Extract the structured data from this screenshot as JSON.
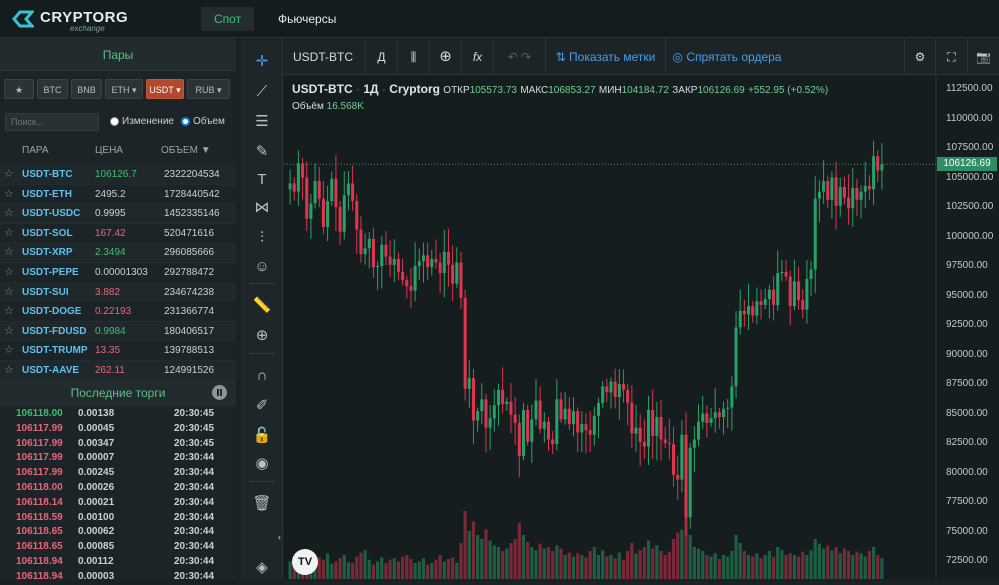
{
  "brand": {
    "name": "CRYPTORG",
    "sub": "exchange"
  },
  "nav": {
    "tabs": [
      {
        "label": "Спот",
        "active": true
      },
      {
        "label": "Фьючерсы",
        "active": false
      }
    ]
  },
  "pairs_panel": {
    "title": "Пары",
    "filters": [
      "BTC",
      "BNB",
      "ETH",
      "USDT",
      "RUB"
    ],
    "active_filter": "USDT",
    "search_placeholder": "Поиск...",
    "radio_change": "Изменение",
    "radio_volume": "Объем",
    "columns": {
      "pair": "ПАРА",
      "price": "ЦЕНА",
      "volume": "ОБЪЕМ ▼"
    },
    "rows": [
      {
        "pair": "USDT-BTC",
        "price": "106126.7",
        "volume": "2322204534",
        "trend": "up"
      },
      {
        "pair": "USDT-ETH",
        "price": "2495.2",
        "volume": "1728440542",
        "trend": "neu"
      },
      {
        "pair": "USDT-USDC",
        "price": "0.9995",
        "volume": "1452335146",
        "trend": "neu"
      },
      {
        "pair": "USDT-SOL",
        "price": "167.42",
        "volume": "520471616",
        "trend": "dn"
      },
      {
        "pair": "USDT-XRP",
        "price": "2.3494",
        "volume": "296085666",
        "trend": "up"
      },
      {
        "pair": "USDT-PEPE",
        "price": "0.00001303",
        "volume": "292788472",
        "trend": "neu"
      },
      {
        "pair": "USDT-SUI",
        "price": "3.882",
        "volume": "234674238",
        "trend": "dn"
      },
      {
        "pair": "USDT-DOGE",
        "price": "0.22193",
        "volume": "231366774",
        "trend": "dn"
      },
      {
        "pair": "USDT-FDUSD",
        "price": "0.9984",
        "volume": "180406517",
        "trend": "up"
      },
      {
        "pair": "USDT-TRUMP",
        "price": "13.35",
        "volume": "139788513",
        "trend": "dn"
      },
      {
        "pair": "USDT-AAVE",
        "price": "262.11",
        "volume": "124991526",
        "trend": "dn"
      }
    ]
  },
  "trades_panel": {
    "title": "Последние торги",
    "rows": [
      {
        "price": "106118.00",
        "qty": "0.00138",
        "time": "20:30:45",
        "side": "up"
      },
      {
        "price": "106117.99",
        "qty": "0.00045",
        "time": "20:30:45",
        "side": "dn"
      },
      {
        "price": "106117.99",
        "qty": "0.00347",
        "time": "20:30:45",
        "side": "dn"
      },
      {
        "price": "106117.99",
        "qty": "0.00007",
        "time": "20:30:44",
        "side": "dn"
      },
      {
        "price": "106117.99",
        "qty": "0.00245",
        "time": "20:30:44",
        "side": "dn"
      },
      {
        "price": "106118.00",
        "qty": "0.00026",
        "time": "20:30:44",
        "side": "dn"
      },
      {
        "price": "106118.14",
        "qty": "0.00021",
        "time": "20:30:44",
        "side": "dn"
      },
      {
        "price": "106118.59",
        "qty": "0.00100",
        "time": "20:30:44",
        "side": "dn"
      },
      {
        "price": "106118.65",
        "qty": "0.00062",
        "time": "20:30:44",
        "side": "dn"
      },
      {
        "price": "106118.65",
        "qty": "0.00085",
        "time": "20:30:44",
        "side": "dn"
      },
      {
        "price": "106118.94",
        "qty": "0.00112",
        "time": "20:30:44",
        "side": "dn"
      },
      {
        "price": "106118.94",
        "qty": "0.00003",
        "time": "20:30:44",
        "side": "dn"
      }
    ]
  },
  "chart_header": {
    "symbol": "USDT-BTC",
    "interval": "Д",
    "show_marks": "Показать метки",
    "hide_orders": "Спрятать ордера"
  },
  "legend": {
    "symbol": "USDT-BTC",
    "interval": "1Д",
    "source": "Cryptorg",
    "open_label": "ОТКР",
    "open": "105573.73",
    "high_label": "МАКС",
    "high": "106853.27",
    "low_label": "МИН",
    "low": "104184.72",
    "close_label": "ЗАКР",
    "close": "106126.69",
    "change": "+552.95 (+0.52%)",
    "volume_label": "Объём",
    "volume": "16.568K"
  },
  "colors": {
    "up": "#26a269",
    "down": "#e0344f",
    "up_text": "#3fbf6f",
    "down_text": "#e8667a"
  },
  "chart_data": {
    "type": "candlestick",
    "y_axis": {
      "min": 72500,
      "max": 112500
    },
    "y_ticks": [
      "112500.00",
      "110000.00",
      "107500.00",
      "105000.00",
      "102500.00",
      "100000.00",
      "97500.00",
      "95000.00",
      "92500.00",
      "90000.00",
      "87500.00",
      "85000.00",
      "82500.00",
      "80000.00",
      "77500.00",
      "75000.00",
      "72500.00"
    ],
    "last_price": "106126.69",
    "closes": [
      104500,
      103800,
      106200,
      105000,
      101500,
      102800,
      104700,
      103200,
      100800,
      103000,
      104900,
      102500,
      100400,
      103500,
      104500,
      103000,
      100600,
      98500,
      99000,
      99800,
      97400,
      97500,
      99300,
      98300,
      97600,
      98100,
      97000,
      96300,
      95800,
      95400,
      97500,
      97900,
      98400,
      97400,
      98100,
      97800,
      96900,
      98700,
      97600,
      96000,
      97800,
      94800,
      87100,
      88000,
      84400,
      85200,
      86200,
      83800,
      84600,
      85700,
      87000,
      85800,
      86000,
      84900,
      84200,
      81400,
      85300,
      82600,
      84500,
      86100,
      83700,
      84300,
      82800,
      82400,
      86200,
      84500,
      85400,
      84100,
      85200,
      83400,
      84100,
      83600,
      83200,
      84800,
      85900,
      87300,
      86800,
      87700,
      86400,
      87500,
      87000,
      85900,
      83300,
      83800,
      82600,
      82200,
      85300,
      83100,
      84700,
      82800,
      82500,
      82400,
      79800,
      79400,
      83200,
      76200,
      82100,
      82800,
      84300,
      85000,
      84200,
      84600,
      85100,
      84700,
      85400,
      85500,
      87300,
      92300,
      93700,
      93400,
      94100,
      93300,
      94500,
      94200,
      94700,
      95500,
      94200,
      96900,
      97000,
      96600,
      94100,
      96200,
      94600,
      93800,
      96400,
      97200,
      103200,
      103800,
      104700,
      103100,
      105000,
      102600,
      104200,
      103300,
      102400,
      104100,
      103100,
      103800,
      104300,
      104000,
      106800,
      105600,
      106126.69
    ],
    "volumes": [
      0.22,
      0.28,
      0.35,
      0.18,
      0.25,
      0.3,
      0.2,
      0.27,
      0.24,
      0.32,
      0.19,
      0.22,
      0.26,
      0.3,
      0.21,
      0.2,
      0.28,
      0.33,
      0.36,
      0.24,
      0.18,
      0.22,
      0.27,
      0.2,
      0.24,
      0.26,
      0.22,
      0.28,
      0.3,
      0.25,
      0.2,
      0.22,
      0.26,
      0.18,
      0.2,
      0.24,
      0.3,
      0.22,
      0.25,
      0.27,
      0.2,
      0.45,
      0.85,
      0.6,
      0.72,
      0.55,
      0.5,
      0.62,
      0.48,
      0.42,
      0.4,
      0.35,
      0.38,
      0.45,
      0.5,
      0.7,
      0.55,
      0.46,
      0.4,
      0.36,
      0.44,
      0.38,
      0.4,
      0.35,
      0.42,
      0.38,
      0.3,
      0.33,
      0.28,
      0.32,
      0.3,
      0.27,
      0.35,
      0.4,
      0.3,
      0.36,
      0.28,
      0.3,
      0.26,
      0.33,
      0.24,
      0.35,
      0.45,
      0.32,
      0.36,
      0.4,
      0.48,
      0.38,
      0.42,
      0.35,
      0.3,
      0.34,
      0.5,
      0.58,
      0.62,
      0.78,
      0.55,
      0.4,
      0.38,
      0.35,
      0.3,
      0.28,
      0.32,
      0.25,
      0.3,
      0.28,
      0.35,
      0.55,
      0.45,
      0.35,
      0.3,
      0.28,
      0.32,
      0.26,
      0.3,
      0.35,
      0.28,
      0.4,
      0.36,
      0.3,
      0.32,
      0.3,
      0.28,
      0.34,
      0.3,
      0.36,
      0.5,
      0.44,
      0.38,
      0.42,
      0.36,
      0.4,
      0.32,
      0.38,
      0.35,
      0.3,
      0.34,
      0.32,
      0.28,
      0.35,
      0.4,
      0.3,
      0.26
    ]
  }
}
